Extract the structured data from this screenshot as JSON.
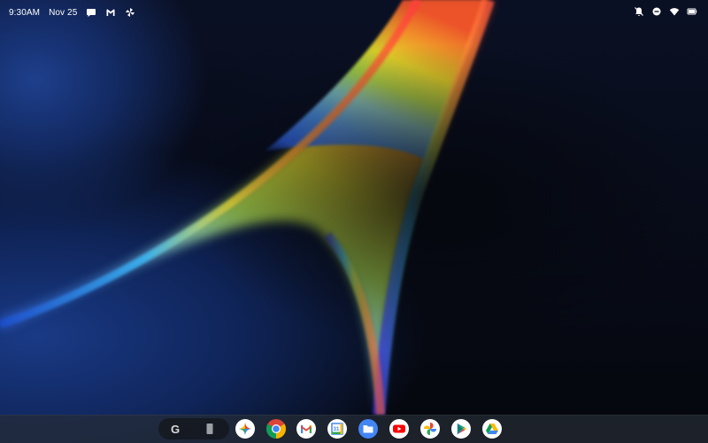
{
  "status_bar": {
    "time": "9:30AM",
    "date": "Nov 25",
    "left_icons": [
      "chat-bubble-icon",
      "gmail-icon",
      "pinwheel-icon"
    ],
    "right_icons": [
      "notifications-off-icon",
      "do-not-disturb-icon",
      "wifi-icon",
      "battery-icon"
    ]
  },
  "shelf": {
    "pill_items": [
      {
        "name": "google-search",
        "icon": "google-g-icon",
        "glyph": "G"
      },
      {
        "name": "tablet-overview",
        "icon": "tablet-icon"
      }
    ],
    "apps": [
      {
        "name": "gemini",
        "icon": "gemini-icon"
      },
      {
        "name": "chrome",
        "icon": "chrome-icon"
      },
      {
        "name": "gmail",
        "icon": "gmail-icon"
      },
      {
        "name": "calendar",
        "icon": "calendar-icon",
        "label": "31"
      },
      {
        "name": "files",
        "icon": "files-icon"
      },
      {
        "name": "youtube",
        "icon": "youtube-icon"
      },
      {
        "name": "photos",
        "icon": "photos-icon"
      },
      {
        "name": "play-store",
        "icon": "play-store-icon"
      },
      {
        "name": "drive",
        "icon": "drive-icon"
      }
    ]
  },
  "colors": {
    "background": "#05070d",
    "wallpaper_blue": "#1a3a86",
    "shelf": "#262c36",
    "status_text": "#ffffff"
  }
}
